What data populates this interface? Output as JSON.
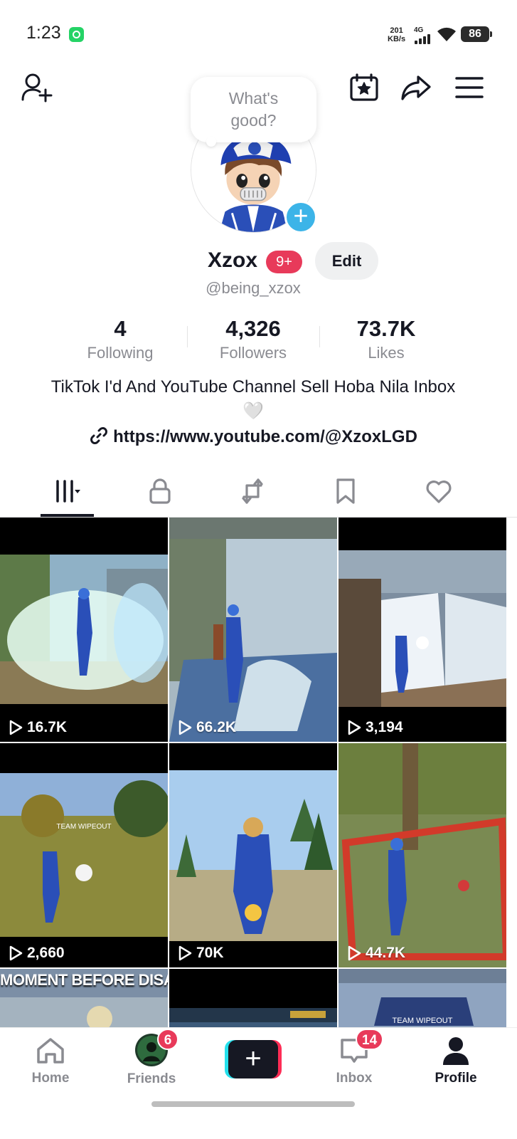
{
  "status_bar": {
    "time": "1:23",
    "speed_value": "201",
    "speed_unit": "KB/s",
    "network": "4G",
    "battery": "86"
  },
  "top_bar": {
    "icons": [
      "add-friend-icon",
      "calendar-star-icon",
      "share-icon",
      "menu-icon"
    ]
  },
  "bubble": {
    "text": "What's good?"
  },
  "profile": {
    "name": "Xzox",
    "badge": "9+",
    "edit_label": "Edit",
    "username": "@being_xzox"
  },
  "stats": [
    {
      "value": "4",
      "label": "Following"
    },
    {
      "value": "4,326",
      "label": "Followers"
    },
    {
      "value": "73.7K",
      "label": "Likes"
    }
  ],
  "bio": {
    "text": "TikTok I'd And YouTube Channel Sell Hoba Nila Inbox 🤍",
    "link": "https://www.youtube.com/@XzoxLGD"
  },
  "tabs": [
    "videos-grid-icon",
    "lock-icon",
    "repost-icon",
    "bookmark-icon",
    "heart-icon"
  ],
  "videos": [
    {
      "views": "16.7K"
    },
    {
      "views": "66.2K"
    },
    {
      "views": "3,194"
    },
    {
      "views": "2,660"
    },
    {
      "views": "70K"
    },
    {
      "views": "44.7K"
    },
    {
      "caption": "MOMENT BEFORE DISASTER..."
    },
    {
      "caption": ""
    },
    {
      "caption": ""
    }
  ],
  "nav": {
    "home": "Home",
    "friends": "Friends",
    "friends_badge": "6",
    "inbox": "Inbox",
    "inbox_badge": "14",
    "profile": "Profile"
  },
  "colors": {
    "accent_red": "#e83a5a",
    "accent_cyan": "#24e0ec",
    "text_primary": "#161823",
    "text_secondary": "#8a8b91"
  }
}
